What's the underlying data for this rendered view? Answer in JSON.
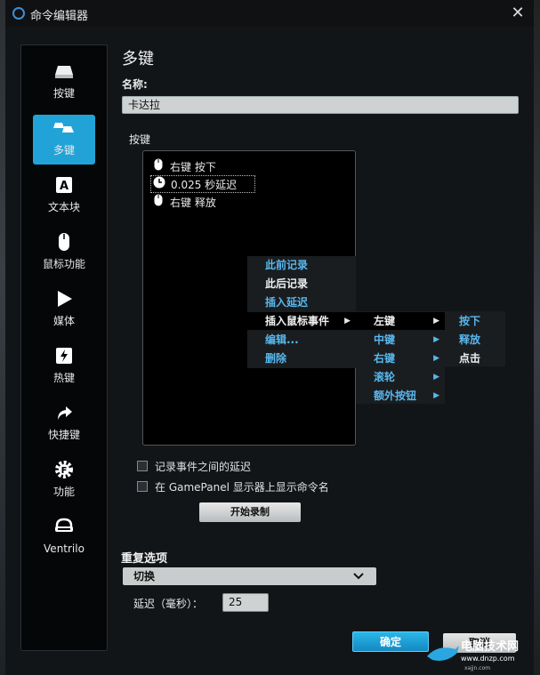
{
  "window": {
    "title": "命令编辑器",
    "close_icon": "close-icon"
  },
  "sidebar": {
    "items": [
      {
        "label": "按键",
        "icon": "key-icon"
      },
      {
        "label": "多键",
        "icon": "multikey-icon",
        "active": true
      },
      {
        "label": "文本块",
        "icon": "text-block-icon"
      },
      {
        "label": "鼠标功能",
        "icon": "mouse-icon"
      },
      {
        "label": "媒体",
        "icon": "play-icon"
      },
      {
        "label": "热键",
        "icon": "hotkey-icon"
      },
      {
        "label": "快捷键",
        "icon": "shortcut-arrow-icon"
      },
      {
        "label": "功能",
        "icon": "gear-icon"
      },
      {
        "label": "Ventrilo",
        "icon": "headset-icon"
      }
    ]
  },
  "content": {
    "title": "多键",
    "name_label": "名称:",
    "name_value": "卡达拉",
    "keys_label": "按键",
    "key_rows": [
      {
        "icon": "mouse-icon",
        "text": "右键 按下"
      },
      {
        "icon": "clock-icon",
        "text": "0.025 秒延迟",
        "selected": true
      },
      {
        "icon": "mouse-icon",
        "text": "右键 释放"
      }
    ]
  },
  "context_menu": {
    "items": [
      {
        "label": "此前记录",
        "color": "#58b8ee"
      },
      {
        "label": "此后记录",
        "color": "#f0f0f0"
      },
      {
        "label": "插入延迟",
        "color": "#58b8ee"
      },
      {
        "label": "插入鼠标事件",
        "color": "#f0f0f0",
        "highlighted": true
      },
      {
        "label": "编辑...",
        "color": "#58b8ee"
      },
      {
        "label": "删除",
        "color": "#58b8ee"
      }
    ]
  },
  "submenu_buttons": {
    "items": [
      {
        "label": "左键",
        "color": "#f0f0f0",
        "highlighted": true
      },
      {
        "label": "中键",
        "color": "#58b8ee"
      },
      {
        "label": "右键",
        "color": "#58b8ee"
      },
      {
        "label": "滚轮",
        "color": "#58b8ee"
      },
      {
        "label": "额外按钮",
        "color": "#58b8ee"
      }
    ]
  },
  "submenu_actions": {
    "items": [
      {
        "label": "按下",
        "color": "#58b8ee"
      },
      {
        "label": "释放",
        "color": "#58b8ee"
      },
      {
        "label": "点击",
        "color": "#f0f0f0"
      }
    ]
  },
  "options": {
    "record_delays": "记录事件之间的延迟",
    "show_in_gamepanel": "在 GamePanel 显示器上显示命令名",
    "start_record": "开始录制"
  },
  "repeat": {
    "label": "重复选项",
    "selected": "切换",
    "delay_label": "延迟（毫秒）：",
    "delay_value": "25"
  },
  "buttons": {
    "ok": "确定",
    "cancel": "取消"
  },
  "watermark": {
    "text": "电脑技术网",
    "url": "www.dnzp.com",
    "sub": "xajjn.com"
  },
  "colors": {
    "accent": "#22a3d8",
    "menu_blue": "#58b8ee"
  }
}
